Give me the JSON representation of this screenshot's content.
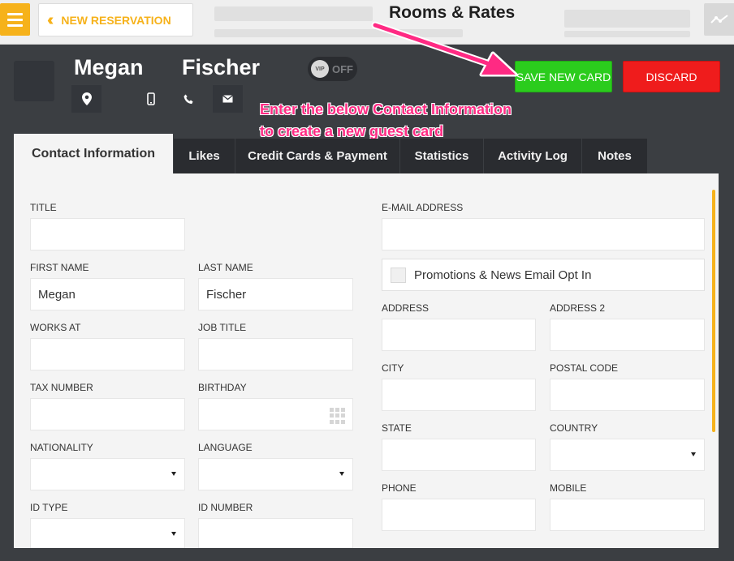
{
  "topbar": {
    "menu_icon": "hamburger-icon",
    "new_reservation_label": "NEW RESERVATION",
    "back_icon": "double-chevron-left-icon",
    "page_title": "Rooms & Rates",
    "graph_icon": "activity-graph-icon"
  },
  "guest": {
    "first_name": "Megan",
    "last_name": "Fischer",
    "vip_badge": "VIP",
    "vip_state": "OFF",
    "icons": [
      "location-pin-icon",
      "mobile-phone-icon",
      "phone-icon",
      "mail-icon"
    ]
  },
  "actions": {
    "save_label": "SAVE NEW CARD",
    "discard_label": "DISCARD"
  },
  "annotation": {
    "line1": "Enter the below Contact Information",
    "line2": "to create a new guest card"
  },
  "tabs": [
    "Contact Information",
    "Likes",
    "Credit Cards & Payment",
    "Statistics",
    "Activity Log",
    "Notes"
  ],
  "form": {
    "title": {
      "label": "TITLE",
      "value": ""
    },
    "first_name": {
      "label": "FIRST NAME",
      "value": "Megan"
    },
    "last_name": {
      "label": "LAST NAME",
      "value": "Fischer"
    },
    "works_at": {
      "label": "WORKS AT",
      "value": ""
    },
    "job_title": {
      "label": "JOB TITLE",
      "value": ""
    },
    "tax_number": {
      "label": "TAX NUMBER",
      "value": ""
    },
    "birthday": {
      "label": "BIRTHDAY",
      "value": ""
    },
    "nationality": {
      "label": "NATIONALITY",
      "value": ""
    },
    "language": {
      "label": "LANGUAGE",
      "value": ""
    },
    "id_type": {
      "label": "ID TYPE",
      "value": ""
    },
    "id_number": {
      "label": "ID NUMBER",
      "value": ""
    },
    "email": {
      "label": "E-MAIL ADDRESS",
      "value": ""
    },
    "optin_label": "Promotions & News Email Opt In",
    "address": {
      "label": "ADDRESS",
      "value": ""
    },
    "address2": {
      "label": "ADDRESS 2",
      "value": ""
    },
    "city": {
      "label": "CITY",
      "value": ""
    },
    "postal_code": {
      "label": "POSTAL CODE",
      "value": ""
    },
    "state": {
      "label": "STATE",
      "value": ""
    },
    "country": {
      "label": "COUNTRY",
      "value": ""
    },
    "phone": {
      "label": "PHONE",
      "value": ""
    },
    "mobile": {
      "label": "MOBILE",
      "value": ""
    }
  },
  "colors": {
    "accent": "#f6b21b",
    "save": "#2bcc1d",
    "discard": "#ef1c1c",
    "annotation": "#ff2a83",
    "header_bg": "#3b3e42"
  }
}
